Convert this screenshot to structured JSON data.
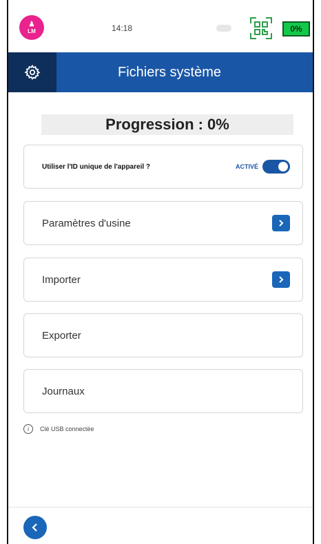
{
  "status": {
    "avatar_initials": "LM",
    "time": "14:18",
    "battery": "0%"
  },
  "header": {
    "title": "Fichiers système",
    "settings_icon": "gear-icon"
  },
  "progress": {
    "text": "Progression : 0%"
  },
  "device_id": {
    "label": "Utiliser l'ID unique de l'appareil ?",
    "state": "ACTIVÉ",
    "enabled": true
  },
  "menu": {
    "factory": "Paramètres d'usine",
    "import": "Importer",
    "export": "Exporter",
    "logs": "Journaux"
  },
  "usb_note": "Clé USB connectée",
  "colors": {
    "primary": "#1a56a6",
    "header_dark": "#0e2f5c",
    "avatar": "#e9228e",
    "battery": "#12c94a"
  }
}
